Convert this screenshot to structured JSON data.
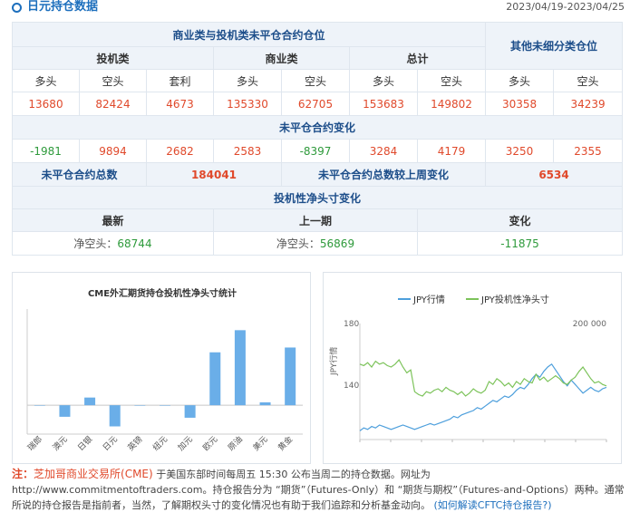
{
  "header": {
    "title": "日元持仓数据",
    "date_range": "2023/04/19-2023/04/25"
  },
  "table": {
    "group_title": "商业类与投机类未平仓合约仓位",
    "other_title": "其他未细分类仓位",
    "noncommercial": "投机类",
    "commercial": "商业类",
    "total": "总计",
    "col_labels": [
      "多头",
      "空头",
      "套利",
      "多头",
      "空头",
      "多头",
      "空头",
      "多头",
      "空头"
    ],
    "positions": [
      "13680",
      "82424",
      "4673",
      "135330",
      "62705",
      "153683",
      "149802",
      "30358",
      "34239"
    ],
    "change_title": "未平仓合约变化",
    "changes": [
      "-1981",
      "9894",
      "2682",
      "2583",
      "-8397",
      "3284",
      "4179",
      "3250",
      "2355"
    ],
    "oi_total_label": "未平仓合约总数",
    "oi_total": "184041",
    "oi_change_label": "未平仓合约总数较上周变化",
    "oi_change": "6534",
    "net_title": "投机性净头寸变化",
    "latest_label": "最新",
    "previous_label": "上一期",
    "change_label": "变化",
    "net_prefix": "净空头：",
    "latest_net": "68744",
    "previous_net": "56869",
    "net_change": "-11875"
  },
  "bar_chart": {
    "title": "CME外汇期货持仓投机性净头寸统计"
  },
  "line_chart": {
    "legend_jpy": "JPY行情",
    "legend_net": "JPY投机性净头寸",
    "left_ticks": [
      "180",
      "140"
    ],
    "right_tick": "200 000",
    "left_axis_label": "JPY行情"
  },
  "chart_data": [
    {
      "type": "bar",
      "title": "CME外汇期货持仓投机性净头寸统计",
      "categories": [
        "瑞郎",
        "澳元",
        "日银",
        "日元",
        "英镑",
        "纽元",
        "加元",
        "欧元",
        "原油",
        "美元",
        "黄金"
      ],
      "values": [
        0,
        -12,
        8,
        -22,
        0,
        0,
        -13,
        55,
        78,
        3,
        60
      ],
      "ylim": [
        -30,
        100
      ],
      "colors": {
        "bar": "#6aaee8"
      }
    },
    {
      "type": "line",
      "series": [
        {
          "name": "JPY行情",
          "color": "#4d9fdc",
          "values": [
            106,
            108,
            107,
            109,
            108,
            110,
            109,
            108,
            107,
            108,
            109,
            110,
            109,
            108,
            107,
            108,
            109,
            110,
            111,
            110,
            111,
            112,
            113,
            114,
            116,
            115,
            117,
            118,
            119,
            120,
            122,
            121,
            123,
            125,
            127,
            126,
            128,
            130,
            129,
            131,
            134,
            136,
            135,
            138,
            142,
            145,
            143,
            147,
            150,
            152,
            148,
            144,
            140,
            137,
            141,
            138,
            135,
            132,
            134,
            136,
            134,
            133,
            135,
            136
          ]
        },
        {
          "name": "JPY投机性净头寸",
          "color": "#7cc35a",
          "values": [
            152,
            151,
            153,
            150,
            154,
            152,
            153,
            151,
            150,
            152,
            155,
            150,
            146,
            148,
            133,
            131,
            130,
            133,
            132,
            134,
            135,
            133,
            136,
            134,
            133,
            131,
            133,
            130,
            132,
            135,
            133,
            132,
            134,
            140,
            138,
            142,
            140,
            137,
            139,
            136,
            140,
            138,
            142,
            140,
            139,
            145,
            141,
            143,
            140,
            142,
            144,
            142,
            139,
            138,
            141,
            143,
            147,
            150,
            146,
            142,
            139,
            140,
            138,
            137
          ]
        }
      ]
    }
  ],
  "footer": {
    "note_tag": "注：",
    "source": "芝加哥商业交易所(CME)",
    "text": "于美国东部时间每周五 15:30 公布当周二的持仓数据。网址为 http://www.commitmentoftraders.com。持仓报告分为 “期货”（Futures-Only）和 “期货与期权”（Futures-and-Options）两种。通常所说的持仓报告是指前者，当然，了解期权头寸的变化情况也有助于我们追踪和分析基金动向。",
    "link": "(如何解读CFTC持仓报告?)"
  }
}
